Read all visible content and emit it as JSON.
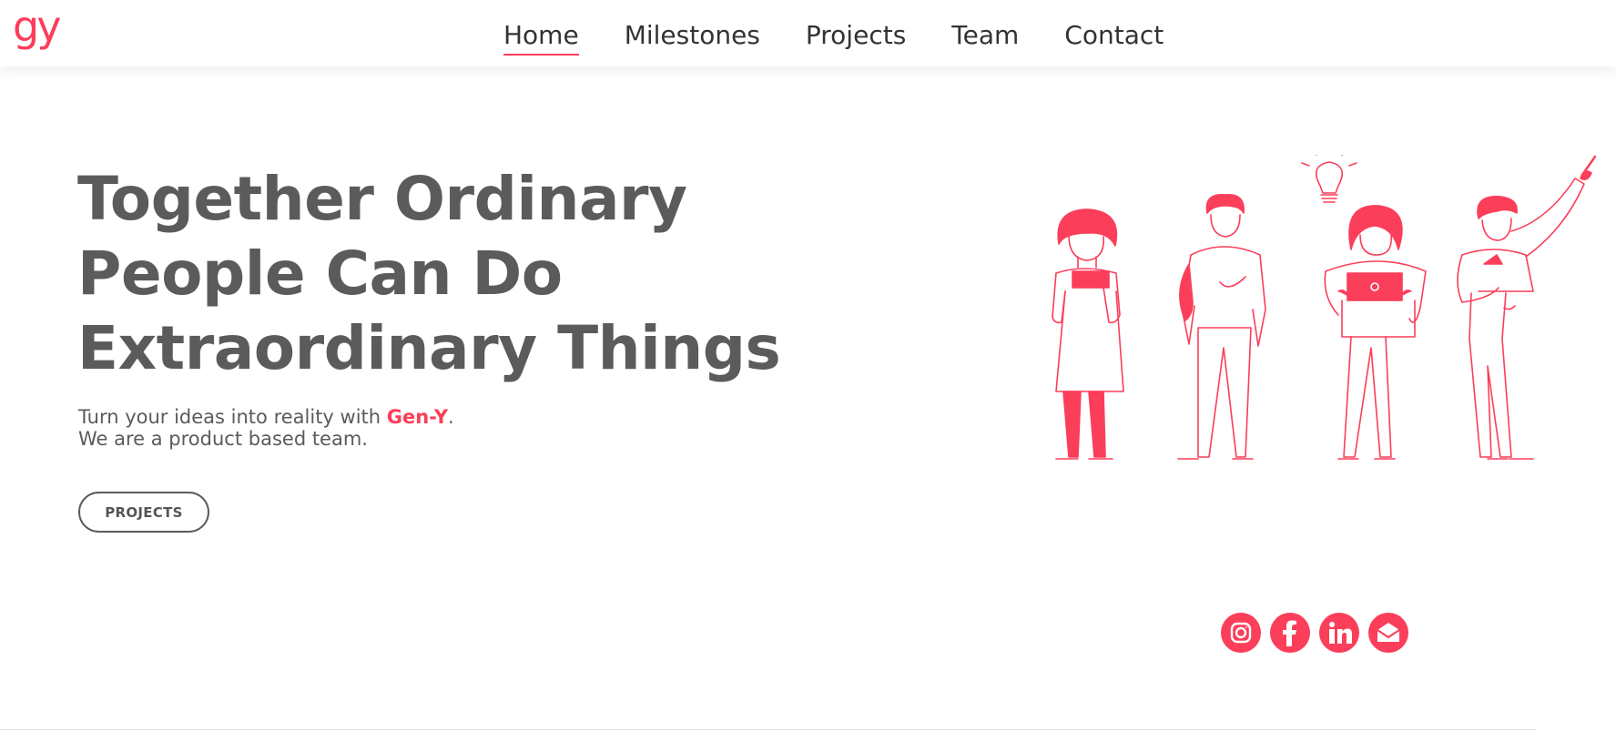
{
  "brand": {
    "logo_text": "gy",
    "accent_color": "#fb3e5a"
  },
  "nav": {
    "items": [
      {
        "label": "Home",
        "active": true
      },
      {
        "label": "Milestones",
        "active": false
      },
      {
        "label": "Projects",
        "active": false
      },
      {
        "label": "Team",
        "active": false
      },
      {
        "label": "Contact",
        "active": false
      }
    ]
  },
  "hero": {
    "title_lines": [
      "Together Ordinary",
      "People Can Do",
      "Extraordinary Things"
    ],
    "subtitle_prefix": "Turn your ideas into reality with ",
    "subtitle_brand": "Gen-Y",
    "subtitle_suffix": ".",
    "subtitle_line2": "We are a product based team.",
    "cta_label": "PROJECTS"
  },
  "illustration": {
    "icon": "people-team-illustration",
    "idea_icon": "lightbulb-icon"
  },
  "social": {
    "icons": [
      "instagram-icon",
      "facebook-icon",
      "linkedin-icon",
      "email-icon"
    ]
  }
}
